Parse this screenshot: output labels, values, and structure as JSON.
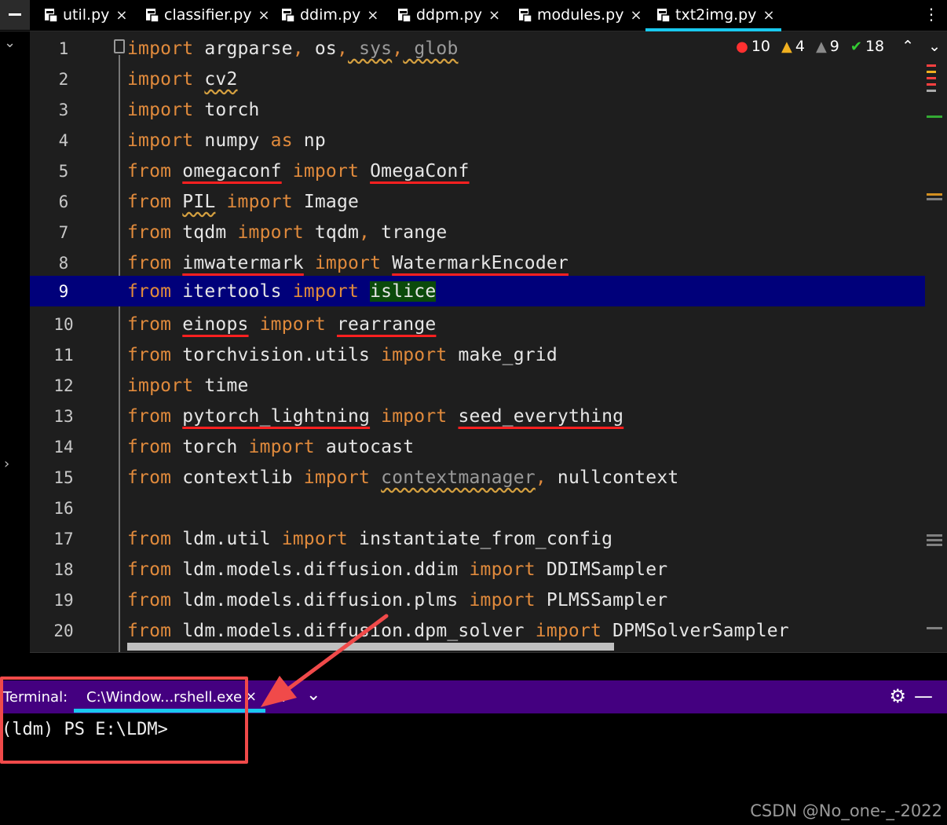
{
  "tabs": [
    {
      "label": "util.py",
      "active": false
    },
    {
      "label": "classifier.py",
      "active": false
    },
    {
      "label": "ddim.py",
      "active": false
    },
    {
      "label": "ddpm.py",
      "active": false
    },
    {
      "label": "modules.py",
      "active": false
    },
    {
      "label": "txt2img.py",
      "active": true
    }
  ],
  "tab_close_glyph": "×",
  "inspections": {
    "errors": "10",
    "warnings": "4",
    "weak_warnings": "9",
    "ok": "18"
  },
  "code_lines": [
    {
      "n": "1"
    },
    {
      "n": "2"
    },
    {
      "n": "3"
    },
    {
      "n": "4"
    },
    {
      "n": "5"
    },
    {
      "n": "6"
    },
    {
      "n": "7"
    },
    {
      "n": "8"
    },
    {
      "n": "9"
    },
    {
      "n": "10"
    },
    {
      "n": "11"
    },
    {
      "n": "12"
    },
    {
      "n": "13"
    },
    {
      "n": "14"
    },
    {
      "n": "15"
    },
    {
      "n": "16"
    },
    {
      "n": "17"
    },
    {
      "n": "18"
    },
    {
      "n": "19"
    },
    {
      "n": "20"
    }
  ],
  "code": {
    "l1": [
      "import",
      " argparse",
      ",",
      " os",
      ",",
      " sys",
      ",",
      " glob"
    ],
    "l2": [
      "import",
      " ",
      "cv2"
    ],
    "l3": [
      "import",
      " torch"
    ],
    "l4": [
      "import",
      " numpy ",
      "as",
      " np"
    ],
    "l5": [
      "from",
      " ",
      "omegaconf",
      " ",
      "import",
      " ",
      "OmegaConf"
    ],
    "l6": [
      "from",
      " ",
      "PIL",
      " ",
      "import",
      " Image"
    ],
    "l7": [
      "from",
      " tqdm ",
      "import",
      " tqdm",
      ",",
      " trange"
    ],
    "l8": [
      "from",
      " ",
      "imwatermark",
      " ",
      "import",
      " ",
      "WatermarkEncoder"
    ],
    "l9": [
      "from",
      " itertools ",
      "import",
      " ",
      "islice"
    ],
    "l10": [
      "from",
      " ",
      "einops",
      " ",
      "import",
      " ",
      "rearrange"
    ],
    "l11": [
      "from",
      " torchvision.utils ",
      "import",
      " make_grid"
    ],
    "l12": [
      "import",
      " time"
    ],
    "l13": [
      "from",
      " ",
      "pytorch_lightning",
      " ",
      "import",
      " ",
      "seed_everything"
    ],
    "l14": [
      "from",
      " torch ",
      "import",
      " autocast"
    ],
    "l15": [
      "from",
      " contextlib ",
      "import",
      " ",
      "contextmanager",
      ",",
      " nullcontext"
    ],
    "l16": [
      ""
    ],
    "l17": [
      "from",
      " ldm.util ",
      "import",
      " instantiate_from_config"
    ],
    "l18": [
      "from",
      " ldm.models.diffusion.ddim ",
      "import",
      " DDIMSampler"
    ],
    "l19": [
      "from",
      " ldm.models.diffusion.plms ",
      "import",
      " PLMSSampler"
    ],
    "l20": [
      "from",
      " ldm.models.diffusion.dpm_solver ",
      "import",
      " DPMSolverSampler"
    ]
  },
  "current_line": "9",
  "terminal": {
    "label": "Terminal:",
    "tab": "C:\\Window...rshell.exe",
    "prompt": "(ldm) PS E:\\LDM>"
  },
  "watermark": "CSDN @No_one-_-2022",
  "colors": {
    "accent": "#19c9ef",
    "terminal_bar": "#440080",
    "keyword": "#e08a3c",
    "annotation": "#f04a4a",
    "current_line": "#00007a"
  }
}
